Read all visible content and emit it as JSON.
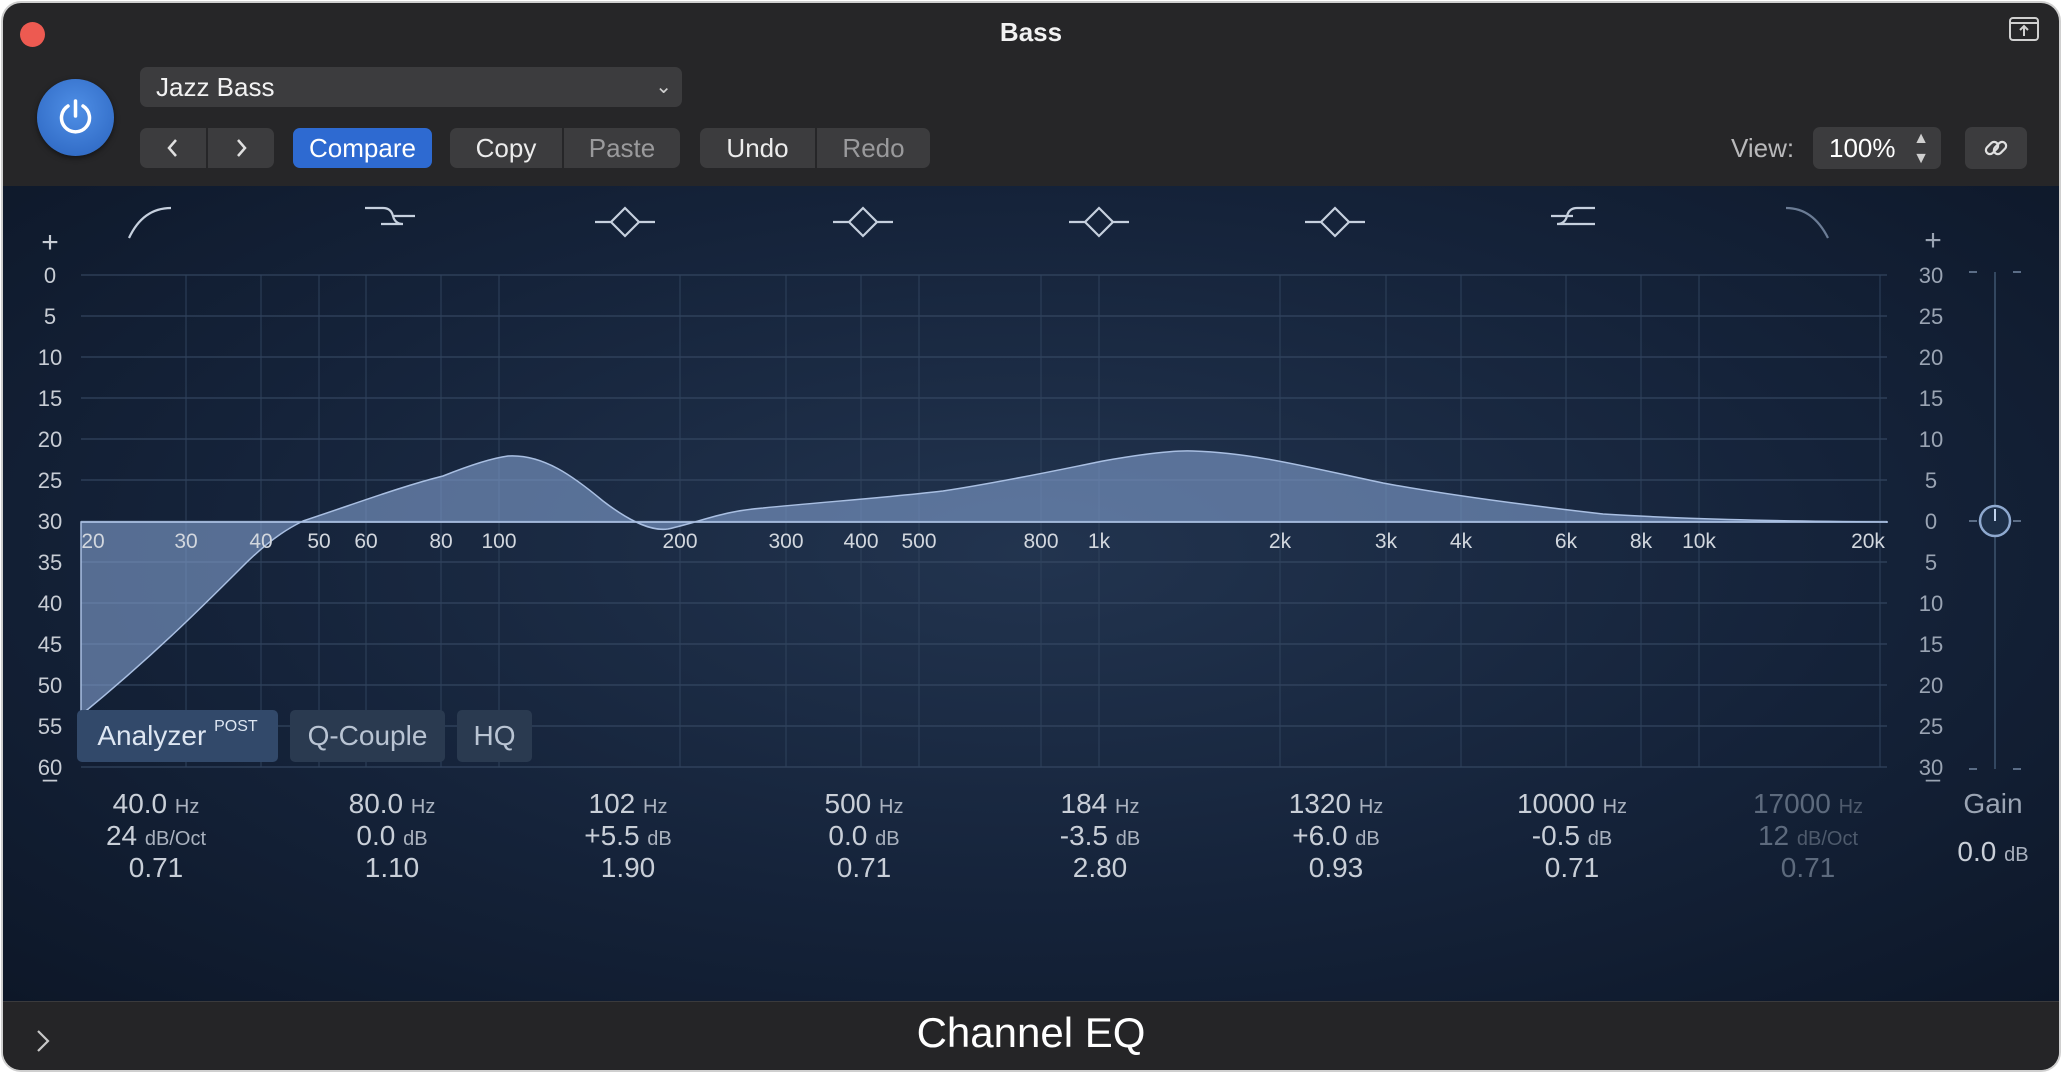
{
  "window": {
    "title": "Bass"
  },
  "header": {
    "preset": "Jazz Bass",
    "compare": "Compare",
    "copy": "Copy",
    "paste": "Paste",
    "undo": "Undo",
    "redo": "Redo",
    "view_label": "View:",
    "view_value": "100%"
  },
  "db_scale_left": [
    "0",
    "5",
    "10",
    "15",
    "20",
    "25",
    "30",
    "35",
    "40",
    "45",
    "50",
    "55",
    "60"
  ],
  "db_scale_right": [
    "30",
    "25",
    "20",
    "15",
    "10",
    "5",
    "0",
    "5",
    "10",
    "15",
    "20",
    "25",
    "30"
  ],
  "plus_sign": "+",
  "minus_sign": "–",
  "freq_labels": [
    "20",
    "30",
    "40",
    "50",
    "60",
    "80",
    "100",
    "200",
    "300",
    "400",
    "500",
    "800",
    "1k",
    "2k",
    "3k",
    "4k",
    "6k",
    "8k",
    "10k",
    "20k"
  ],
  "bands": [
    {
      "freq": "40.0",
      "freq_unit": "Hz",
      "gain": "24",
      "gain_unit": "dB/Oct",
      "q": "0.71",
      "icon": "low-cut-icon",
      "active": true
    },
    {
      "freq": "80.0",
      "freq_unit": "Hz",
      "gain": "0.0",
      "gain_unit": "dB",
      "q": "1.10",
      "icon": "low-shelf-icon",
      "active": true
    },
    {
      "freq": "102",
      "freq_unit": "Hz",
      "gain": "+5.5",
      "gain_unit": "dB",
      "q": "1.90",
      "icon": "peak-icon",
      "active": true
    },
    {
      "freq": "500",
      "freq_unit": "Hz",
      "gain": "0.0",
      "gain_unit": "dB",
      "q": "0.71",
      "icon": "peak-icon",
      "active": true
    },
    {
      "freq": "184",
      "freq_unit": "Hz",
      "gain": "-3.5",
      "gain_unit": "dB",
      "q": "2.80",
      "icon": "peak-icon",
      "active": true
    },
    {
      "freq": "1320",
      "freq_unit": "Hz",
      "gain": "+6.0",
      "gain_unit": "dB",
      "q": "0.93",
      "icon": "peak-icon",
      "active": true
    },
    {
      "freq": "10000",
      "freq_unit": "Hz",
      "gain": "-0.5",
      "gain_unit": "dB",
      "q": "0.71",
      "icon": "high-shelf-icon",
      "active": true
    },
    {
      "freq": "17000",
      "freq_unit": "Hz",
      "gain": "12",
      "gain_unit": "dB/Oct",
      "q": "0.71",
      "icon": "high-cut-icon",
      "active": false
    }
  ],
  "gain": {
    "label": "Gain",
    "value": "0.0",
    "unit": "dB"
  },
  "options": {
    "analyzer": "Analyzer",
    "analyzer_tag": "POST",
    "qcouple": "Q-Couple",
    "hq": "HQ"
  },
  "footer": {
    "title": "Channel EQ"
  },
  "colors": {
    "accent": "#2e6ad1",
    "curve_fill": "#7f9ccc",
    "panel": "#15233a"
  }
}
